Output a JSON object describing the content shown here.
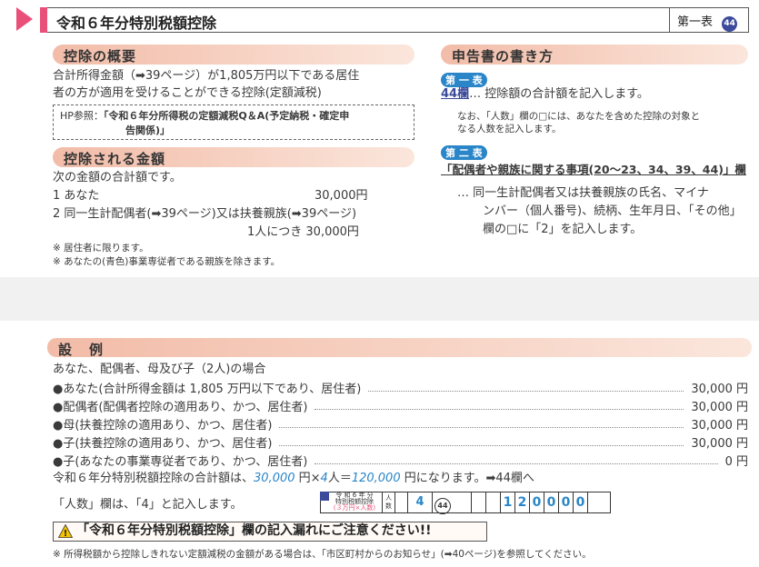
{
  "banner": {
    "title": "令和６年分特別税額控除",
    "table_label": "第一表",
    "table_number": "44"
  },
  "overview": {
    "heading": "控除の概要",
    "line1": "合計所得金額（➡39ページ）が1,805万円以下である居住",
    "line2": "者の方が適用を受けることができる控除(定額減税)",
    "hp_label": "HP参照：",
    "hp_text1": "「令和６年分所得税の定額減税Q＆A(予定納税・確定申",
    "hp_text2": "告関係)」"
  },
  "amount": {
    "heading": "控除される金額",
    "intro": "次の金額の合計額です。",
    "item1_label": "1 あなた",
    "item1_value": "30,000円",
    "item2_label": "2 同一生計配偶者(➡39ページ)又は扶養親族(➡39ページ)",
    "item2_value": "1人につき 30,000円",
    "note1": "※ 居住者に限ります。",
    "note2": "※ あなたの(青色)事業専従者である親族を除きます。"
  },
  "howto": {
    "heading": "申告書の書き方",
    "table1_tag": "第 一 表",
    "table1_field": "44欄",
    "table1_text": "… 控除額の合計額を記入します。",
    "table1_note1": "なお、「人数」欄の□には、あなたを含めた控除の対象と",
    "table1_note2": "なる人数を記入します。",
    "table2_tag": "第 二 表",
    "table2_title": "「配偶者や親族に関する事項(20～23、34、39、44)」欄",
    "table2_line1": "… 同一生計配偶者又は扶養親族の氏名、マイナ",
    "table2_line2": "ンバー（個人番号)、続柄、生年月日、「その他」",
    "table2_line3": "欄の□に「2」を記入します。"
  },
  "example": {
    "heading": "設　例",
    "intro": "あなた、配偶者、母及び子（2人)の場合",
    "rows": [
      {
        "label": "●あなた(合計所得金額は 1,805 万円以下であり、居住者)",
        "value": "30,000 円"
      },
      {
        "label": "●配偶者(配偶者控除の適用あり、かつ、居住者)",
        "value": "30,000 円"
      },
      {
        "label": "●母(扶養控除の適用あり、かつ、居住者)",
        "value": "30,000 円"
      },
      {
        "label": "●子(扶養控除の適用あり、かつ、居住者)",
        "value": "30,000 円"
      },
      {
        "label": "●子(あなたの事業専従者であり、かつ、居住者)",
        "value": "0 円"
      }
    ],
    "total_prefix": "令和６年分特別税額控除の合計額は、",
    "total_a": "30,000",
    "total_mid": " 円×",
    "total_b": "4",
    "total_mid2": "人＝",
    "total_c": "120,000",
    "total_suffix": " 円になります。➡44欄へ",
    "count_note": "「人数」欄は、「4」と記入します。",
    "form_label1": "令 和 6 年 分",
    "form_label2": "特別税額控除",
    "form_label3": "(３万円×人数)",
    "form_people_label": "人数",
    "form_people_value": "4",
    "form_field": "44",
    "form_digits": [
      "1",
      "2",
      "0",
      "0",
      "0",
      "0"
    ],
    "warning": "「令和６年分特別税額控除」欄の記入漏れにご注意ください!!",
    "footnote": "※ 所得税額から控除しきれない定額減税の金額がある場合は、「市区町村からのお知らせ」(➡40ページ)を参照してください。"
  },
  "colors": {
    "accent_pink": "#e8507a",
    "heading_band": "#f2bca8",
    "blue": "#2a86c8",
    "navy": "#3b4a9a"
  }
}
